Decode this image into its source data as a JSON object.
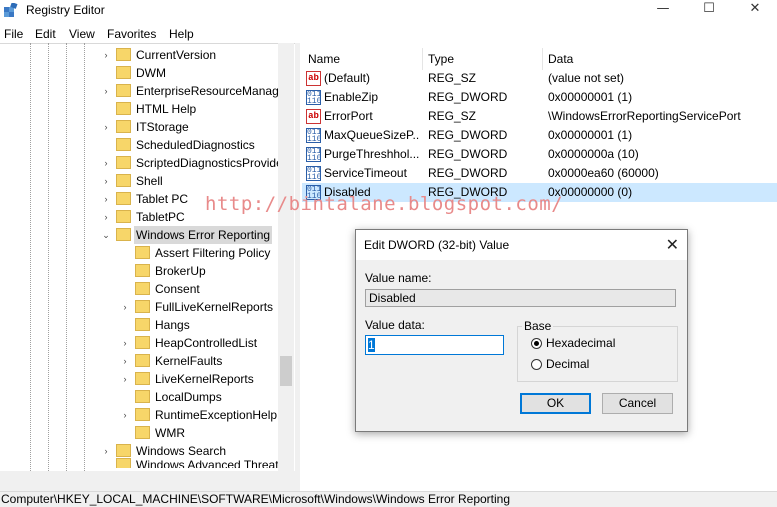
{
  "window": {
    "title": "Registry Editor",
    "min_glyph": "—",
    "max_glyph": "☐",
    "close_glyph": "✕"
  },
  "menu": [
    "File",
    "Edit",
    "View",
    "Favorites",
    "Help"
  ],
  "tree": {
    "items": [
      {
        "label": "CurrentVersion"
      },
      {
        "label": "DWM"
      },
      {
        "label": "EnterpriseResourceManage"
      },
      {
        "label": "HTML Help"
      },
      {
        "label": "ITStorage"
      },
      {
        "label": "ScheduledDiagnostics"
      },
      {
        "label": "ScriptedDiagnosticsProvide"
      },
      {
        "label": "Shell"
      },
      {
        "label": "Tablet PC"
      },
      {
        "label": "TabletPC"
      },
      {
        "label": "Windows Error Reporting"
      },
      {
        "label": "Assert Filtering Policy"
      },
      {
        "label": "BrokerUp"
      },
      {
        "label": "Consent"
      },
      {
        "label": "FullLiveKernelReports"
      },
      {
        "label": "Hangs"
      },
      {
        "label": "HeapControlledList"
      },
      {
        "label": "KernelFaults"
      },
      {
        "label": "LiveKernelReports"
      },
      {
        "label": "LocalDumps"
      },
      {
        "label": "RuntimeExceptionHelp"
      },
      {
        "label": "WMR"
      },
      {
        "label": "Windows Search"
      },
      {
        "label": "Windows Advanced Threat Pr"
      }
    ]
  },
  "list": {
    "headers": {
      "name": "Name",
      "type": "Type",
      "data": "Data"
    },
    "rows": [
      {
        "name": "(Default)",
        "type": "REG_SZ",
        "data": "(value not set)",
        "icon": "string-value-icon"
      },
      {
        "name": "EnableZip",
        "type": "REG_DWORD",
        "data": "0x00000001 (1)",
        "icon": "dword-value-icon"
      },
      {
        "name": "ErrorPort",
        "type": "REG_SZ",
        "data": "\\WindowsErrorReportingServicePort",
        "icon": "string-value-icon"
      },
      {
        "name": "MaxQueueSizeP...",
        "type": "REG_DWORD",
        "data": "0x00000001 (1)",
        "icon": "dword-value-icon"
      },
      {
        "name": "PurgeThreshhol...",
        "type": "REG_DWORD",
        "data": "0x0000000a (10)",
        "icon": "dword-value-icon"
      },
      {
        "name": "ServiceTimeout",
        "type": "REG_DWORD",
        "data": "0x0000ea60 (60000)",
        "icon": "dword-value-icon"
      },
      {
        "name": "Disabled",
        "type": "REG_DWORD",
        "data": "0x00000000 (0)",
        "icon": "dword-value-icon"
      }
    ],
    "icon_text": {
      "string": "ab",
      "dword": "011 110"
    }
  },
  "watermark": "http://bintalane.blogspot.com/",
  "status": {
    "path": "Computer\\HKEY_LOCAL_MACHINE\\SOFTWARE\\Microsoft\\Windows\\Windows Error Reporting"
  },
  "dialog": {
    "title": "Edit DWORD (32-bit) Value",
    "close_glyph": "✕",
    "value_name_label": "Value name:",
    "value_name": "Disabled",
    "value_data_label": "Value data:",
    "value_data": "1",
    "base_label": "Base",
    "hex_label": "Hexadecimal",
    "dec_label": "Decimal",
    "selected_base": "Hexadecimal",
    "ok_label": "OK",
    "cancel_label": "Cancel"
  }
}
